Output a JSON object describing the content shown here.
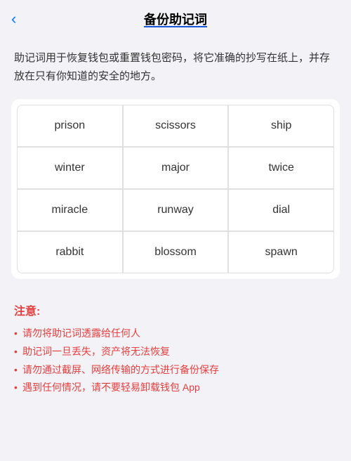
{
  "header": {
    "back_label": "‹",
    "title": "备份助记词"
  },
  "description": {
    "text": "助记词用于恢复钱包或重置钱包密码，将它准确的抄写在纸上，并存放在只有你知道的安全的地方。"
  },
  "mnemonic": {
    "words": [
      "prison",
      "scissors",
      "ship",
      "winter",
      "major",
      "twice",
      "miracle",
      "runway",
      "dial",
      "rabbit",
      "blossom",
      "spawn"
    ]
  },
  "notes": {
    "title": "注意:",
    "items": [
      "请勿将助记词透露给任何人",
      "助记词一旦丢失，资产将无法恢复",
      "请勿通过截屏、网络传输的方式进行备份保存",
      "遇到任何情况，请不要轻易卸载钱包 App"
    ]
  }
}
